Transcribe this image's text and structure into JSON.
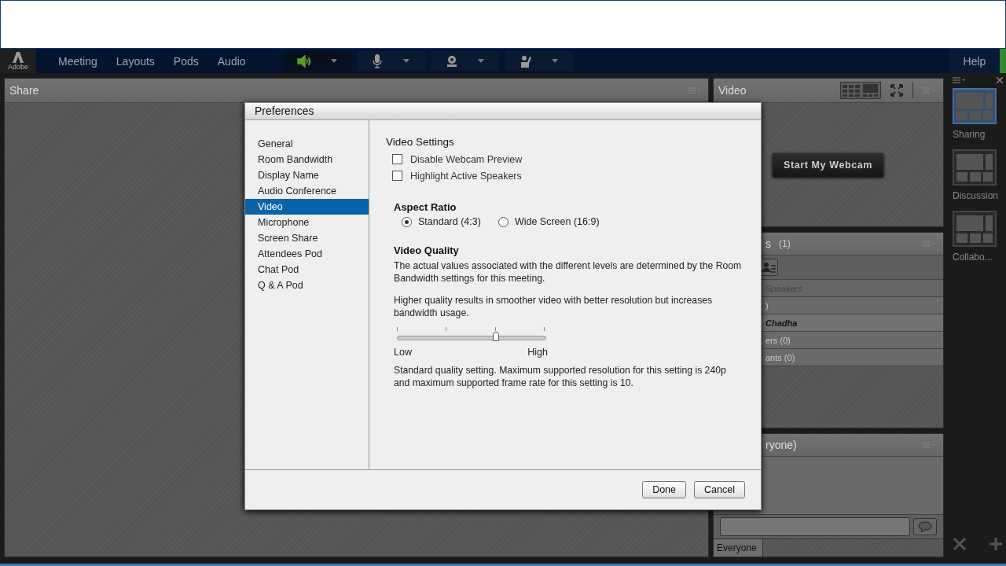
{
  "menubar": {
    "logo": "Adobe",
    "menus": [
      "Meeting",
      "Layouts",
      "Pods",
      "Audio"
    ],
    "help": "Help"
  },
  "share_pod": {
    "title": "Share"
  },
  "video_pod": {
    "title": "Video",
    "webcam_button": "Start My Webcam"
  },
  "attendees_pod": {
    "title": "s",
    "count": "(1)",
    "rows": [
      {
        "kind": "placeholder",
        "text": "Speakers"
      },
      {
        "kind": "group",
        "text": ")"
      },
      {
        "kind": "person",
        "text": "Chadha"
      },
      {
        "kind": "group",
        "text": "ers (0)"
      },
      {
        "kind": "group",
        "text": "ants (0)"
      }
    ]
  },
  "chat_pod": {
    "title": "ryone)",
    "recipient": "Everyone"
  },
  "layouts": [
    {
      "label": "Sharing",
      "selected": true
    },
    {
      "label": "Discussion",
      "selected": false
    },
    {
      "label": "Collabo...",
      "selected": false
    }
  ],
  "dialog": {
    "title": "Preferences",
    "categories": [
      {
        "label": "General",
        "selected": false
      },
      {
        "label": "Room Bandwidth",
        "selected": false
      },
      {
        "label": "Display Name",
        "selected": false
      },
      {
        "label": "Audio Conference",
        "selected": false
      },
      {
        "label": "Video",
        "selected": true
      },
      {
        "label": "Microphone",
        "selected": false
      },
      {
        "label": "Screen Share",
        "selected": false
      },
      {
        "label": "Attendees Pod",
        "selected": false
      },
      {
        "label": "Chat Pod",
        "selected": false
      },
      {
        "label": "Q & A Pod",
        "selected": false
      }
    ],
    "section_title": "Video Settings",
    "checkboxes": [
      {
        "label": "Disable Webcam Preview",
        "checked": false
      },
      {
        "label": "Highlight Active Speakers",
        "checked": false
      }
    ],
    "aspect_title": "Aspect Ratio",
    "aspect_options": [
      {
        "label": "Standard (4:3)",
        "selected": true
      },
      {
        "label": "Wide Screen (16:9)",
        "selected": false
      }
    ],
    "quality_title": "Video Quality",
    "paragraphs": [
      "The actual values associated with the different levels are determined by the Room Bandwidth settings for this meeting.",
      "Higher quality results in smoother video with better resolution but increases bandwidth usage."
    ],
    "slider": {
      "level": 0.667,
      "low": "Low",
      "high": "High"
    },
    "description": "Standard quality setting. Maximum supported resolution for this setting is 240p and maximum supported frame rate for this setting is 10.",
    "buttons": [
      "Done",
      "Cancel"
    ]
  }
}
